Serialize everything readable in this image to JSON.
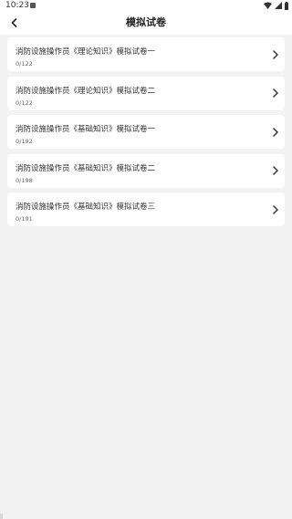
{
  "status_bar": {
    "time": "10:23",
    "icons": [
      "notification-icon",
      "wifi-icon",
      "cellular-icon",
      "battery-icon"
    ]
  },
  "header": {
    "back_icon": "chevron-left-icon",
    "title": "模拟试卷"
  },
  "exams": [
    {
      "title": "消防设施操作员《理论知识》模拟试卷一",
      "progress": "0/122"
    },
    {
      "title": "消防设施操作员《理论知识》模拟试卷二",
      "progress": "0/122"
    },
    {
      "title": "消防设施操作员《基础知识》模拟试卷一",
      "progress": "0/192"
    },
    {
      "title": "消防设施操作员《基础知识》模拟试卷二",
      "progress": "0/198"
    },
    {
      "title": "消防设施操作员《基础知识》模拟试卷三",
      "progress": "0/191"
    }
  ],
  "colors": {
    "background": "#f2f2f2",
    "card": "#ffffff",
    "text_primary": "#333333",
    "text_secondary": "#666666"
  }
}
